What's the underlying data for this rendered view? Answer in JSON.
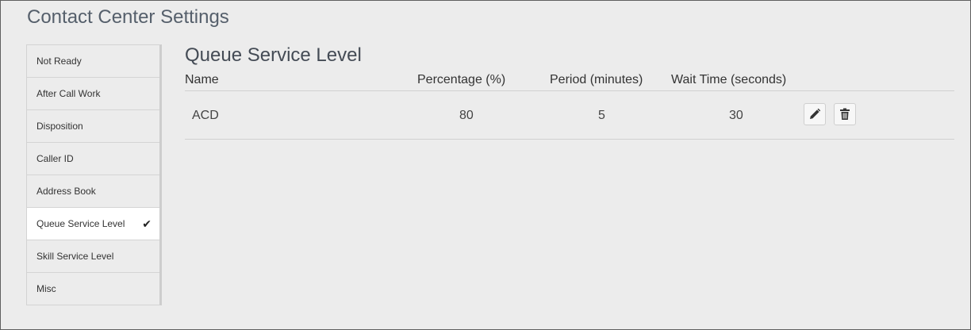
{
  "header": {
    "title": "Contact Center Settings"
  },
  "sidebar": {
    "items": [
      {
        "label": "Not Ready"
      },
      {
        "label": "After Call Work"
      },
      {
        "label": "Disposition"
      },
      {
        "label": "Caller ID"
      },
      {
        "label": "Address Book"
      },
      {
        "label": "Queue Service Level",
        "selected": true
      },
      {
        "label": "Skill Service Level"
      },
      {
        "label": "Misc"
      }
    ],
    "selected_mark": "✔"
  },
  "main": {
    "title": "Queue Service Level",
    "columns": {
      "name": "Name",
      "percentage": "Percentage (%)",
      "period": "Period (minutes)",
      "wait_time": "Wait Time (seconds)"
    },
    "rows": [
      {
        "name": "ACD",
        "percentage": "80",
        "period": "5",
        "wait_time": "30",
        "actions": [
          "pencil-icon",
          "trash-icon"
        ]
      }
    ]
  },
  "colors": {
    "background": "#ececec",
    "title_text": "#555f6b",
    "selected_item": "#ffffff"
  }
}
